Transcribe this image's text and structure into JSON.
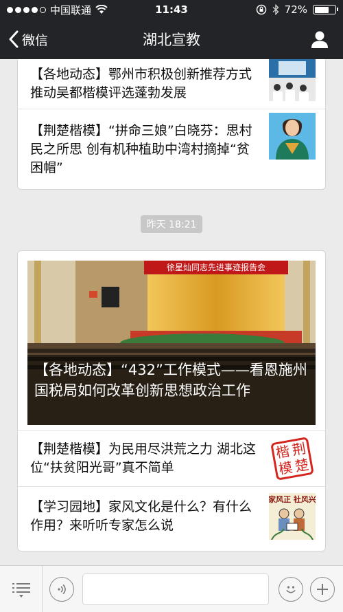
{
  "status_bar": {
    "carrier": "中国联通",
    "time": "11:43",
    "battery": "72%",
    "battery_level": 0.72
  },
  "nav": {
    "back_label": "微信",
    "title": "湖北宣教"
  },
  "card1": {
    "items": [
      {
        "text": "【各地动态】鄂州市积极创新推荐方式 推动吴都楷模评选蓬勃发展"
      },
      {
        "text": "【荆楚楷模】“拼命三娘”白晓芬：思村民之所思 创有机种植助中湾村摘掉“贫困帽”"
      }
    ]
  },
  "timestamp": "昨天 18:21",
  "card2": {
    "hero": {
      "banner_text": "徐星灿同志先进事迹报告会",
      "caption": "【各地动态】“432”工作模式——看恩施州国税局如何改革创新思想政治工作"
    },
    "items": [
      {
        "text": "【荆楚楷模】为民用尽洪荒之力 湖北这位“扶贫阳光哥”真不简单",
        "thumb_text": "楷荆模楚"
      },
      {
        "text": "【学习园地】家风文化是什么？有什么作用？来听听专家怎么说",
        "thumb_text": "家风正 社风兴"
      }
    ]
  }
}
